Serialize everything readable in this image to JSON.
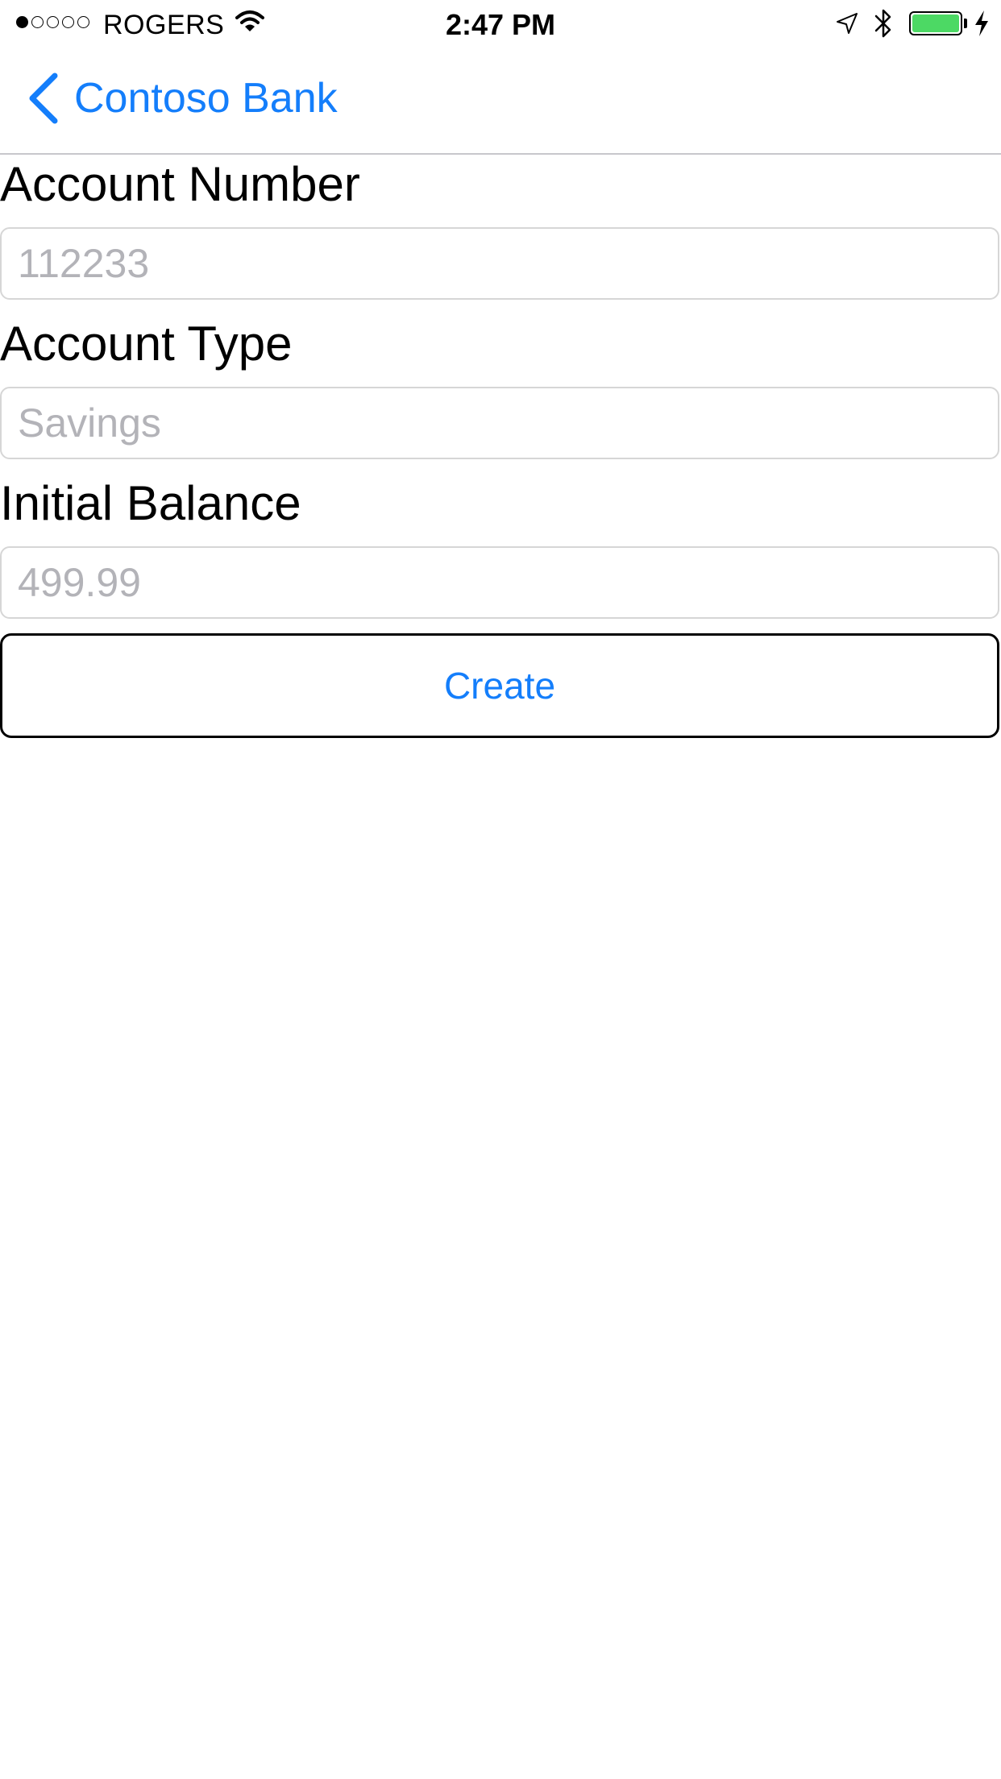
{
  "status_bar": {
    "signal_bars_filled": 1,
    "signal_bars_total": 5,
    "carrier": "ROGERS",
    "time": "2:47 PM",
    "battery_level": 1.0,
    "battery_color": "#4cd964",
    "icons": [
      "wifi-icon",
      "location-icon",
      "bluetooth-icon",
      "battery-icon",
      "charging-icon"
    ]
  },
  "nav": {
    "back_label": "Contoso Bank",
    "accent_color": "#147efb"
  },
  "form": {
    "account_number": {
      "label": "Account Number",
      "placeholder": "112233"
    },
    "account_type": {
      "label": "Account Type",
      "placeholder": "Savings"
    },
    "initial_balance": {
      "label": "Initial Balance",
      "placeholder": "499.99"
    },
    "create_label": "Create"
  }
}
